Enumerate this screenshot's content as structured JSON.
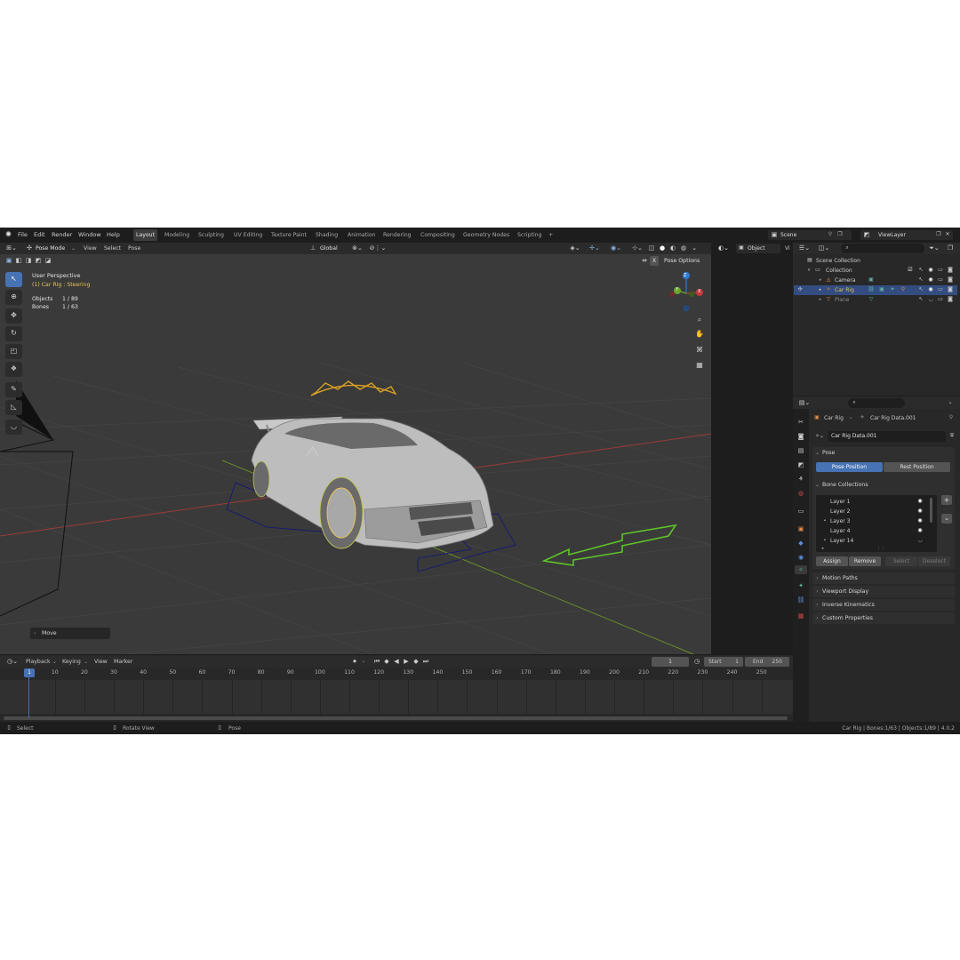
{
  "menubar": {
    "items": [
      "File",
      "Edit",
      "Render",
      "Window",
      "Help"
    ],
    "workspaces": [
      "Layout",
      "Modeling",
      "Sculpting",
      "UV Editing",
      "Texture Paint",
      "Shading",
      "Animation",
      "Rendering",
      "Compositing",
      "Geometry Nodes",
      "Scripting"
    ],
    "active_workspace": "Layout",
    "add_tab": "+",
    "scene": "Scene",
    "view_layer": "ViewLayer"
  },
  "viewport_header": {
    "mode": "Pose Mode",
    "menus": [
      "View",
      "Select",
      "Pose"
    ],
    "orientation": "Global",
    "pose_options": "Pose Options",
    "x_label": "X"
  },
  "viewport_overlay": {
    "perspective": "User Perspective",
    "active": "(1) Car Rig : Steering",
    "objects_label": "Objects",
    "objects_value": "1 / 89",
    "bones_label": "Bones",
    "bones_value": "1 / 63",
    "last_operator": "Move"
  },
  "gizmo": {
    "x": "X",
    "y": "Y",
    "z": "Z"
  },
  "outliner": {
    "search_placeholder": "",
    "root": "Scene Collection",
    "collection": "Collection",
    "rows": [
      {
        "name": "Camera"
      },
      {
        "name": "Car Rig"
      },
      {
        "name": "Plane"
      }
    ],
    "object_label": "Object",
    "vi_label": "Vi"
  },
  "properties": {
    "breadcrumb_object": "Car Rig",
    "breadcrumb_data": "Car Rig Data.001",
    "datablock": "Car Rig Data.001",
    "pose_header": "Pose",
    "pose_position": "Pose Position",
    "rest_position": "Rest Position",
    "bone_collections_header": "Bone Collections",
    "layers": [
      "Layer 1",
      "Layer 2",
      "Layer 3",
      "Layer 4",
      "Layer 14"
    ],
    "assign": "Assign",
    "remove": "Remove",
    "select": "Select",
    "deselect": "Deselect",
    "sections": [
      "Motion Paths",
      "Viewport Display",
      "Inverse Kinematics",
      "Custom Properties"
    ]
  },
  "timeline": {
    "menus": [
      "Playback",
      "Keying",
      "View",
      "Marker"
    ],
    "current_frame": "1",
    "start_label": "Start",
    "start_value": "1",
    "end_label": "End",
    "end_value": "250",
    "ticks": [
      "10",
      "20",
      "30",
      "40",
      "50",
      "60",
      "70",
      "80",
      "90",
      "100",
      "110",
      "120",
      "130",
      "140",
      "150",
      "160",
      "170",
      "180",
      "190",
      "200",
      "210",
      "220",
      "230",
      "240",
      "250"
    ],
    "playhead": "1"
  },
  "statusbar": {
    "select": "Select",
    "rotate_view": "Rotate View",
    "pose": "Pose",
    "stats": "Car Rig | Bones:1/63 | Objects:1/89 | 4.0.2"
  },
  "colors": {
    "accent": "#4772b3",
    "active_text": "#e8c25a",
    "background": "#1d1d1d",
    "viewport": "#3a3a3a"
  }
}
